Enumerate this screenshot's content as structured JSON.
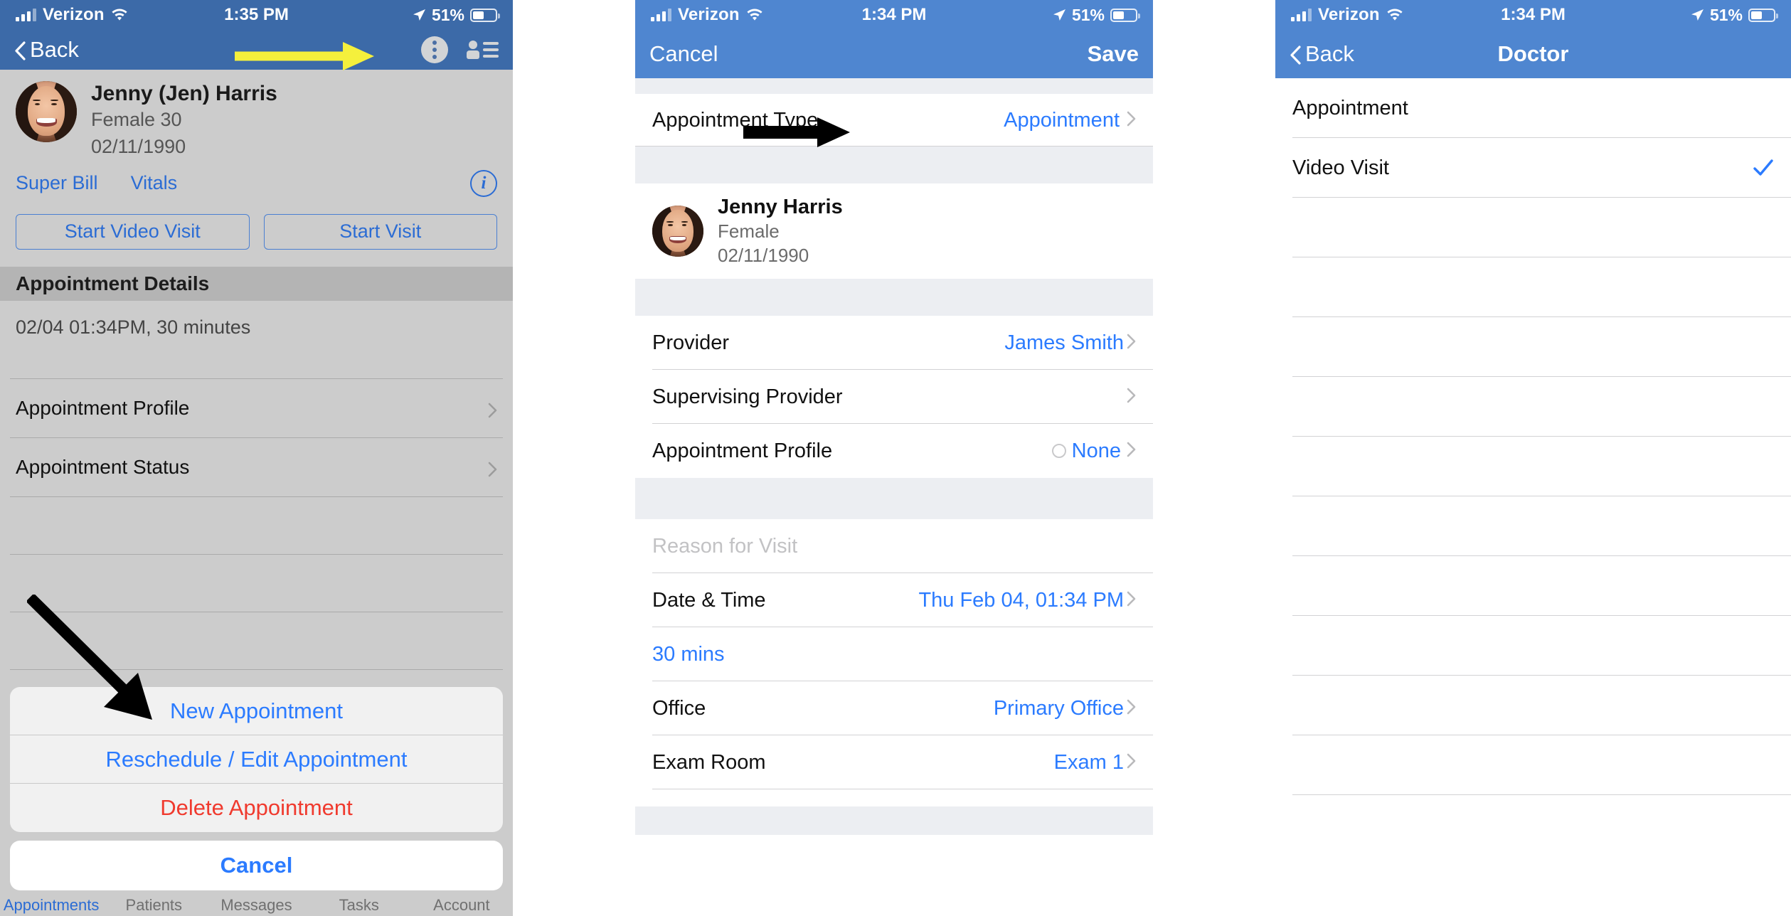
{
  "panel1": {
    "status": {
      "carrier": "Verizon",
      "time": "1:35 PM",
      "battery_pct": "51%",
      "wifi_icon": "wifi-icon",
      "signal_icon": "cellular-bars-icon",
      "location_icon": "location-arrow-icon",
      "battery_icon": "battery-icon"
    },
    "nav": {
      "back_label": "Back",
      "kebab_icon": "more-options-kebab-icon",
      "person_list_icon": "person-list-icon",
      "back_chevron_icon": "chevron-left-icon"
    },
    "patient": {
      "name": "Jenny (Jen) Harris",
      "gender_age": "Female 30",
      "dob": "02/11/1990",
      "avatar_icon": "patient-avatar"
    },
    "links": {
      "super_bill": "Super Bill",
      "vitals": "Vitals",
      "info_icon": "info-circle-icon"
    },
    "buttons": {
      "start_video_visit": "Start Video Visit",
      "start_visit": "Start Visit"
    },
    "section_header": "Appointment Details",
    "appointment_summary": "02/04 01:34PM, 30 minutes",
    "rows": [
      {
        "label": "Appointment Profile",
        "chevron_icon": "chevron-right-icon"
      },
      {
        "label": "Appointment Status",
        "chevron_icon": "chevron-right-icon"
      }
    ],
    "action_sheet": {
      "items": [
        {
          "label": "New Appointment",
          "style": "normal"
        },
        {
          "label": "Reschedule / Edit Appointment",
          "style": "normal"
        },
        {
          "label": "Delete Appointment",
          "style": "destructive"
        }
      ],
      "cancel_label": "Cancel"
    },
    "tabbar": [
      {
        "label": "Appointments",
        "active": true
      },
      {
        "label": "Patients",
        "active": false
      },
      {
        "label": "Messages",
        "active": false
      },
      {
        "label": "Tasks",
        "active": false
      },
      {
        "label": "Account",
        "active": false
      }
    ],
    "annotations": {
      "yellow_arrow": "yellow-arrow-pointing-to-kebab-menu",
      "black_arrow": "black-arrow-pointing-to-reschedule-edit-appointment"
    }
  },
  "panel2": {
    "status": {
      "carrier": "Verizon",
      "time": "1:34 PM",
      "battery_pct": "51%",
      "wifi_icon": "wifi-icon",
      "signal_icon": "cellular-bars-icon",
      "location_icon": "location-arrow-icon",
      "battery_icon": "battery-icon"
    },
    "nav": {
      "cancel_label": "Cancel",
      "save_label": "Save"
    },
    "appointment_type": {
      "label": "Appointment Type",
      "value": "Appointment",
      "chevron_icon": "chevron-right-icon"
    },
    "patient": {
      "name": "Jenny Harris",
      "gender": "Female",
      "dob": "02/11/1990",
      "avatar_icon": "patient-avatar"
    },
    "rows": [
      {
        "label": "Provider",
        "value": "James Smith",
        "chevron_icon": "chevron-right-icon"
      },
      {
        "label": "Supervising Provider",
        "value": "",
        "chevron_icon": "chevron-right-icon"
      },
      {
        "label": "Appointment Profile",
        "value": "None",
        "radio_icon": "radio-unselected-icon",
        "chevron_icon": "chevron-right-icon"
      }
    ],
    "reason_placeholder": "Reason for Visit",
    "datetime": {
      "label": "Date & Time",
      "value": "Thu Feb 04, 01:34 PM",
      "chevron_icon": "chevron-right-icon"
    },
    "duration": "30 mins",
    "office": {
      "label": "Office",
      "value": "Primary Office",
      "chevron_icon": "chevron-right-icon"
    },
    "exam_room": {
      "label": "Exam Room",
      "value": "Exam 1",
      "chevron_icon": "chevron-right-icon"
    },
    "annotations": {
      "black_arrow": "black-arrow-pointing-to-appointment-type-value"
    }
  },
  "panel3": {
    "status": {
      "carrier": "Verizon",
      "time": "1:34 PM",
      "battery_pct": "51%",
      "wifi_icon": "wifi-icon",
      "signal_icon": "cellular-bars-icon",
      "location_icon": "location-arrow-icon",
      "battery_icon": "battery-icon"
    },
    "nav": {
      "back_label": "Back",
      "title": "Doctor",
      "back_chevron_icon": "chevron-left-icon"
    },
    "options": [
      {
        "label": "Appointment",
        "selected": false
      },
      {
        "label": "Video Visit",
        "selected": true,
        "check_icon": "checkmark-icon"
      }
    ],
    "empty_row_count": 10
  },
  "colors": {
    "nav_blue_dark": "#3c6aa8",
    "nav_blue_light": "#4f86d0",
    "tint_blue": "#2b7bff",
    "link_blue": "#2b6cd4",
    "destructive_red": "#f03a2e",
    "panel1_bg": "#cccccc",
    "group_bg": "#eceef2",
    "annotation_yellow": "#f5f03c",
    "annotation_black": "#000000"
  }
}
